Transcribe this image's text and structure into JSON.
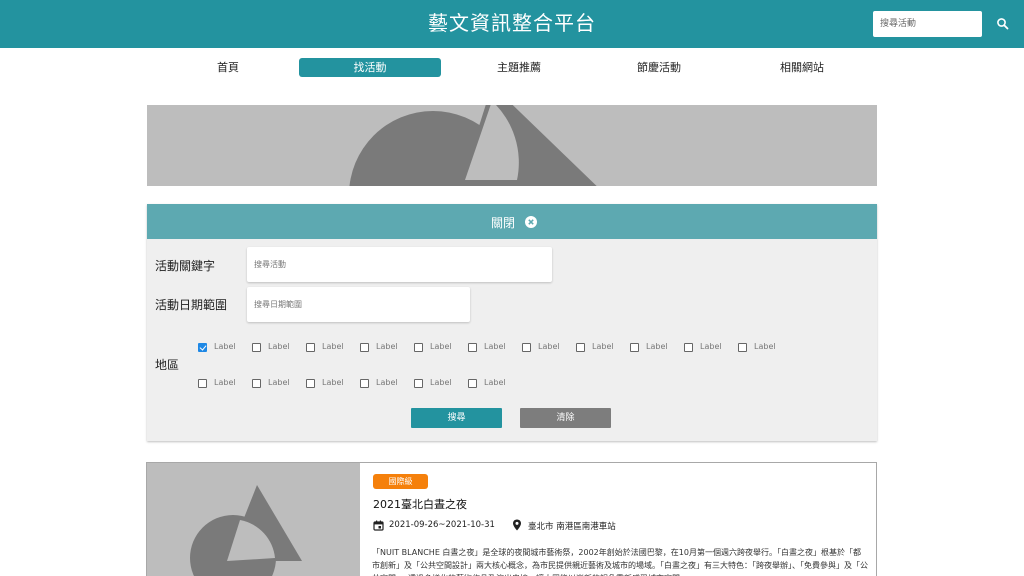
{
  "header": {
    "title": "藝文資訊整合平台",
    "search_placeholder": "搜尋活動"
  },
  "nav": {
    "items": [
      {
        "label": "首頁"
      },
      {
        "label": "找活動"
      },
      {
        "label": "主題推薦"
      },
      {
        "label": "節慶活動"
      },
      {
        "label": "相關網站"
      }
    ]
  },
  "filter": {
    "close_label": "關閉",
    "keyword_label": "活動關鍵字",
    "keyword_placeholder": "搜尋活動",
    "date_label": "活動日期範圍",
    "date_placeholder": "搜尋日期範圍",
    "region_label": "地區",
    "checkbox_label": "Label",
    "search_button": "搜尋",
    "clear_button": "清除"
  },
  "event": {
    "badge": "國際級",
    "title": "2021臺北白晝之夜",
    "date_range": "2021-09-26~2021-10-31",
    "location": "臺北市 南港區南港車站",
    "description": "「NUIT BLANCHE 白晝之夜」是全球的夜間城市藝術祭，2002年創始於法國巴黎，在10月第一個週六跨夜舉行。「白晝之夜」根基於「都市創新」及「公共空間設計」兩大核心概念，為市民提供親近藝術及城市的場域。「白晝之夜」有三大特色：「跨夜舉辦」、「免費參與」及「公共空間」，透過多樣化的藝術作品及演出串接，讓大眾能以嶄新的視角重新感受城市空間"
  },
  "colors": {
    "primary": "#23939f",
    "panel_header": "#5da9b1",
    "badge": "#f5800b",
    "checkbox_checked": "#1e88e5"
  }
}
